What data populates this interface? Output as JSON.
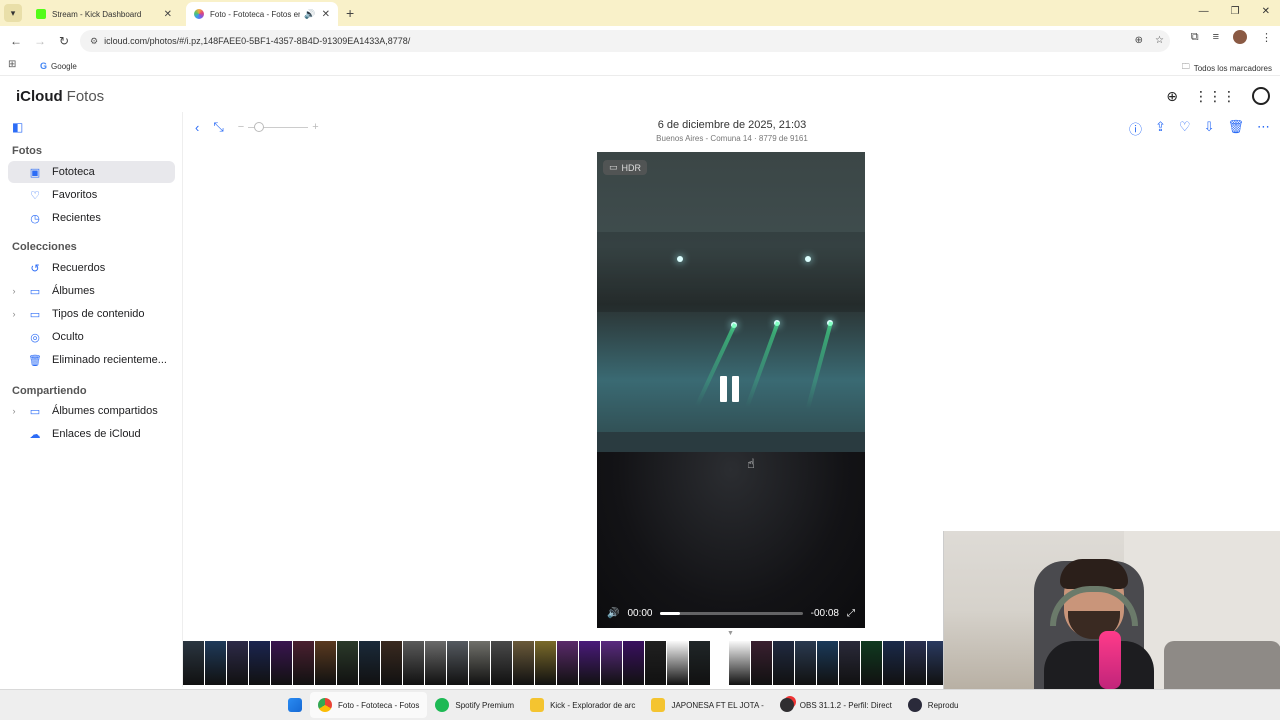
{
  "browser": {
    "tabs": [
      {
        "title": "Stream - Kick Dashboard",
        "favicon_color": "#53fc18",
        "active": false
      },
      {
        "title": "Foto - Fototeca - Fotos en",
        "favicon_color": "#f4a93b",
        "active": true
      }
    ],
    "url": "icloud.com/photos/#/i.pz,148FAEE0-5BF1-4357-8B4D-91309EA1433A,8778/",
    "bookmarks": {
      "google": "Google",
      "all": "Todos los marcadores"
    }
  },
  "app": {
    "brand_main": "iCloud",
    "brand_sub": "Fotos"
  },
  "sidebar": {
    "sections": [
      {
        "title": "Fotos",
        "items": [
          {
            "label": "Fototeca",
            "icon": "photo-library-icon",
            "glyph": "▣",
            "selected": true,
            "expandable": false
          },
          {
            "label": "Favoritos",
            "icon": "heart-icon",
            "glyph": "♡",
            "selected": false,
            "expandable": false
          },
          {
            "label": "Recientes",
            "icon": "clock-icon",
            "glyph": "◷",
            "selected": false,
            "expandable": false
          }
        ]
      },
      {
        "title": "Colecciones",
        "items": [
          {
            "label": "Recuerdos",
            "icon": "memories-icon",
            "glyph": "↺",
            "selected": false,
            "expandable": false
          },
          {
            "label": "Álbumes",
            "icon": "albums-icon",
            "glyph": "▭",
            "selected": false,
            "expandable": true
          },
          {
            "label": "Tipos de contenido",
            "icon": "media-types-icon",
            "glyph": "▭",
            "selected": false,
            "expandable": true
          },
          {
            "label": "Oculto",
            "icon": "hidden-eye-icon",
            "glyph": "◎",
            "selected": false,
            "expandable": false
          },
          {
            "label": "Eliminado recienteme...",
            "icon": "trash-icon",
            "glyph": "🗑",
            "selected": false,
            "expandable": false
          }
        ]
      },
      {
        "title": "Compartiendo",
        "items": [
          {
            "label": "Álbumes compartidos",
            "icon": "shared-albums-icon",
            "glyph": "▭",
            "selected": false,
            "expandable": true
          },
          {
            "label": "Enlaces de iCloud",
            "icon": "icloud-link-icon",
            "glyph": "☁",
            "selected": false,
            "expandable": false
          }
        ]
      }
    ]
  },
  "viewer": {
    "date": "6 de diciembre de 2025, 21:03",
    "subtitle": "Buenos Aires - Comuna 14 · 8779 de 9161",
    "hdr_label": "HDR",
    "time_elapsed": "00:00",
    "time_remaining": "-00:08",
    "progress": 0.14
  },
  "filmstrip": {
    "thumb_colors": [
      "#2a3540",
      "#1f3a5a",
      "#2d2a48",
      "#1b2550",
      "#3a1550",
      "#4a2030",
      "#5a3a20",
      "#2b3a2a",
      "#1a2a3a",
      "#3a2a20",
      "#5a5a5a",
      "#6a6a6a",
      "#555a60",
      "#70706a",
      "#4a4a4a",
      "#6a5a3a",
      "#7a6a2a",
      "#5a2a6a",
      "#4a1a7a",
      "#5a2a80",
      "#3a1060",
      "#202020",
      "#fafafa",
      "#202628",
      "#fafafa",
      "#3a2030",
      "#202a40",
      "#2a3a50",
      "#1a3a5a",
      "#2a2a3a",
      "#103a20",
      "#1a2a4a",
      "#2a3050",
      "#2a3a60",
      "#1a2040"
    ],
    "marker": "▼"
  },
  "taskbar": {
    "items": [
      {
        "label": "Foto - Fototeca - Fotos",
        "color": "#4285f4",
        "active": true
      },
      {
        "label": "Spotify Premium",
        "color": "#1db954",
        "active": false
      },
      {
        "label": "Kick - Explorador de arc",
        "color": "#f4c430",
        "active": false
      },
      {
        "label": "JAPONESA FT EL JOTA -",
        "color": "#f4c430",
        "active": false
      },
      {
        "label": "OBS 31.1.2 - Perfil: Direct",
        "color": "#302e31",
        "active": false
      },
      {
        "label": "Reprodu",
        "color": "#2a2a3a",
        "active": false
      }
    ]
  }
}
